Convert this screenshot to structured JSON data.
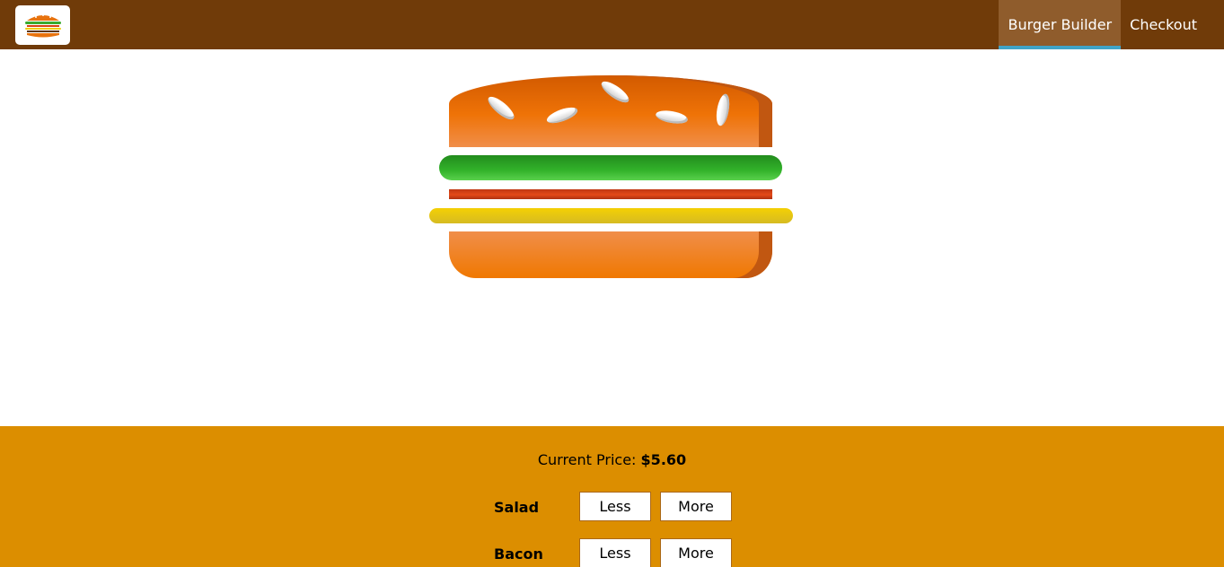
{
  "toolbar": {
    "logo_icon": "burger-logo-icon",
    "nav": [
      {
        "label": "Burger Builder",
        "active": true
      },
      {
        "label": "Checkout",
        "active": false
      }
    ]
  },
  "burger": {
    "ingredients": [
      "salad",
      "bacon",
      "cheese"
    ]
  },
  "build_controls": {
    "price_label": "Current Price:",
    "price_value": "$5.60",
    "controls": [
      {
        "label": "Salad",
        "less_label": "Less",
        "more_label": "More"
      },
      {
        "label": "Bacon",
        "less_label": "Less",
        "more_label": "More"
      }
    ]
  },
  "colors": {
    "toolbar": "#703b09",
    "active_nav": "#8f5c2c",
    "active_underline": "#40a4c8",
    "controls_bg": "#dc8e00"
  }
}
